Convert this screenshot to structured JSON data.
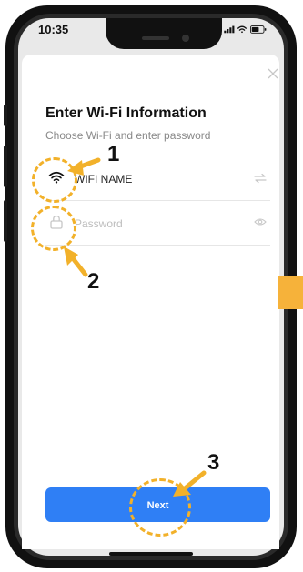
{
  "status_bar": {
    "time": "10:35"
  },
  "wifi_form": {
    "title": "Enter Wi-Fi Information",
    "subtitle": "Choose Wi-Fi and enter password",
    "ssid_value": "WIFI NAME",
    "password_placeholder": "Password",
    "next_label": "Next"
  },
  "annotations": {
    "step1": "1",
    "step2": "2",
    "step3": "3"
  },
  "colors": {
    "accent_blue": "#2f7ff5",
    "annotation_orange": "#f2b12a"
  },
  "icons": {
    "close": "close-icon",
    "wifi": "wifi-icon",
    "lock": "lock-icon",
    "switch": "switch-arrows-icon",
    "eye": "eye-icon"
  }
}
